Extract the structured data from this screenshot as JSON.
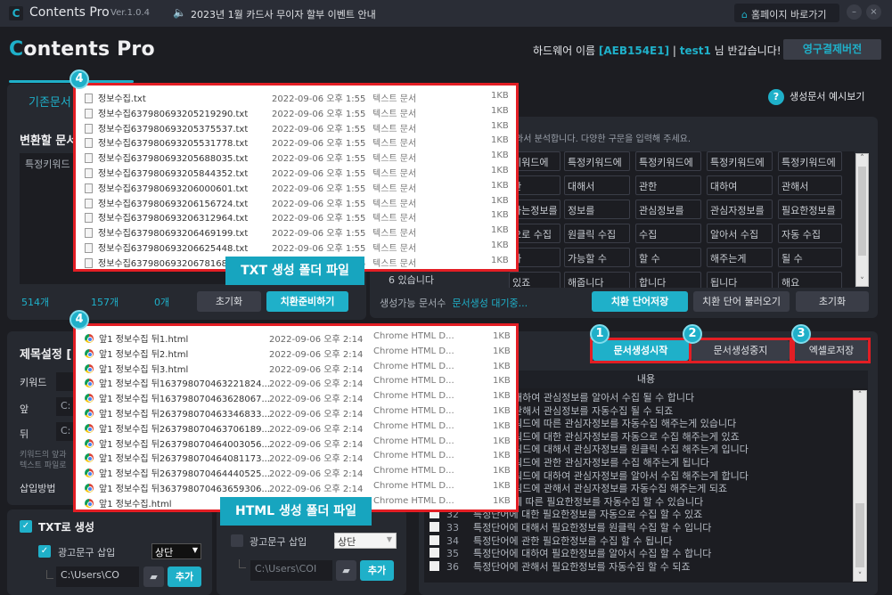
{
  "titlebar": {
    "app_name": "Contents Pro",
    "version": "Ver.1.0.4",
    "notice": "2023년 1월 카드사 무이자 할부 이벤트 안내",
    "homepage_label": "홈페이지 바로가기",
    "minimize": "–",
    "close": "×"
  },
  "header": {
    "brand_c": "C",
    "brand_rest": "ontents Pro",
    "hw_prefix": "하드웨어 이름 ",
    "hw_id": "[AEB154E1]",
    "separator": " | ",
    "user": "test1",
    "greeting": " 님 반갑습니다!",
    "permanent_btn": "영구결제버전"
  },
  "left_top": {
    "tab": "기존문서",
    "section_label": "변환할 문서",
    "textarea_preview": "특정키워드",
    "counts": [
      "514개",
      "157개",
      "0개"
    ],
    "reset_btn": "초기화",
    "prepare_btn": "치환준비하기"
  },
  "right_top": {
    "help_label": "생성문서 예시보기",
    "hint": "와서 분석합니다. 다양한 구문을 입력해 주세요.",
    "words": [
      [
        "키워드에",
        "특정키워드에",
        "특정키워드에",
        "특정키워드에",
        "특정키워드에"
      ],
      [
        "한",
        "대해서",
        "관한",
        "대하여",
        "관해서"
      ],
      [
        "하는정보를",
        "정보를",
        "관심정보를",
        "관심자정보를",
        "필요한정보를"
      ],
      [
        "으로 수집",
        "원클릭 수집",
        "수집",
        "알아서 수집",
        "자동 수집"
      ],
      [
        "가",
        "가능할 수",
        "할 수",
        "해주는게",
        "될 수"
      ],
      [
        "있죠",
        "해줍니다",
        "합니다",
        "됩니다",
        "해요"
      ]
    ],
    "partial_row": "6  있습니다",
    "possible_label": "생성가능 문서수",
    "possible_status": "문서생성 대기중...",
    "save_words_btn": "치환 단어저장",
    "load_words_btn": "치환 단어 불러오기",
    "reset_btn": "초기화"
  },
  "title_settings": {
    "title": "제목설정 [",
    "keyword_label": "키워드",
    "front_label": "앞",
    "back_label": "뒤",
    "front_value": "C:",
    "back_value": "C:",
    "note_line1": "키워드의 앞과",
    "note_line2": "텍스트 파일로",
    "insert_label": "삽입방법"
  },
  "txt_gen": {
    "label": "TXT로 생성",
    "checked": true,
    "ad_label": "광고문구 삽입",
    "ad_checked": true,
    "position": "상단",
    "path": "C:\\Users\\CO",
    "add_btn": "추가"
  },
  "html_gen": {
    "ad_label": "광고문구 삽입",
    "ad_checked": false,
    "position": "상단",
    "path": "C:\\Users\\COI",
    "add_btn": "추가"
  },
  "actions": {
    "start_btn": "문서생성시작",
    "stop_btn": "문서생성중지",
    "excel_btn": "엑셀로저장",
    "badges": [
      "1",
      "2",
      "3",
      "4",
      "4"
    ]
  },
  "content_list": {
    "header": "내용",
    "rows": [
      {
        "num": "",
        "text": "대하여 관심정보를 알아서 수집 될 수  합니다"
      },
      {
        "num": "",
        "text": "관해서 관심정보를 자동수집 될 수  되죠"
      },
      {
        "num": "",
        "text": "워드에 따른 관심자정보를 자동수집 해주는게 있습니다"
      },
      {
        "num": "",
        "text": "워드에 대한 관심자정보를 자동으로 수집 해주는게 있죠"
      },
      {
        "num": "",
        "text": "워드에 대해서 관심자정보를 원클릭 수집 해주는게 입니다"
      },
      {
        "num": "",
        "text": "워드에 관한 관심자정보를 수집 해주는게 됩니다"
      },
      {
        "num": "",
        "text": "워드에 대하여 관심자정보를 알아서 수집 해주는게 합니다"
      },
      {
        "num": "",
        "text": "워드에 관해서 관심자정보를 자동수집 해주는게 되죠"
      },
      {
        "num": "",
        "text": "에 따른 필요한정보를 자동수집 할 수 있습니다"
      },
      {
        "num": "32",
        "text": "특정단어에 대한 필요한정보를 자동으로 수집 할 수 있죠"
      },
      {
        "num": "33",
        "text": "특정단어에 대해서 필요한정보를 원클릭 수집 할 수 입니다"
      },
      {
        "num": "34",
        "text": "특정단어에 관한 필요한정보를 수집 할 수 됩니다"
      },
      {
        "num": "35",
        "text": "특정단어에 대하여 필요한정보를 알아서 수집 할 수 합니다"
      },
      {
        "num": "36",
        "text": "특정단어에 관해서 필요한정보를 자동수집 할 수 되죠"
      }
    ]
  },
  "txt_files": {
    "caption": "TXT 생성 폴더 파일",
    "date": "2022-09-06 오후 1:55",
    "type": "텍스트 문서",
    "size": "1KB",
    "names": [
      "정보수집.txt",
      "정보수집637980693205219290.txt",
      "정보수집637980693205375537.txt",
      "정보수집637980693205531778.txt",
      "정보수집637980693205688035.txt",
      "정보수집637980693205844352.txt",
      "정보수집637980693206000601.txt",
      "정보수집637980693206156724.txt",
      "정보수집637980693206312964.txt",
      "정보수집637980693206469199.txt",
      "정보수집637980693206625448.txt",
      "정보수집637980693206781687.txt"
    ]
  },
  "html_files": {
    "caption": "HTML 생성 폴더 파일",
    "date": "2022-09-06 오후 2:14",
    "type": "Chrome HTML D...",
    "size": "1KB",
    "names": [
      "앞1 정보수집 뒤1.html",
      "앞1 정보수집 뒤2.html",
      "앞1 정보수집 뒤3.html",
      "앞1 정보수집 뒤163798070463221824...",
      "앞1 정보수집 뒤163798070463628067...",
      "앞1 정보수집 뒤263798070463346833...",
      "앞1 정보수집 뒤263798070463706189...",
      "앞1 정보수집 뒤263798070464003056...",
      "앞1 정보수집 뒤263798070464081173...",
      "앞1 정보수집 뒤263798070464440525...",
      "앞1 정보수집 뒤363798070463659306...",
      "앞1 정보수집.html"
    ]
  },
  "colors": {
    "accent": "#1fb0c9",
    "highlight": "#e31e24",
    "bg": "#1c1d22",
    "panel": "#262930"
  }
}
